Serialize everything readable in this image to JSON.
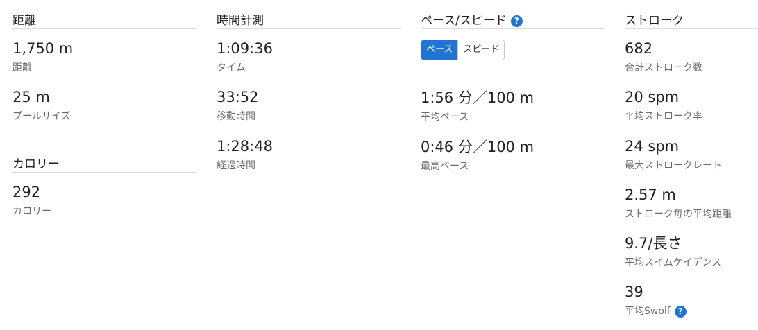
{
  "col1": {
    "title": "距離",
    "stats": [
      {
        "value": "1,750 m",
        "label": "距離"
      },
      {
        "value": "25 m",
        "label": "プールサイズ"
      }
    ],
    "calorie_title": "カロリー",
    "calorie_stats": [
      {
        "value": "292",
        "label": "カロリー"
      }
    ]
  },
  "col2": {
    "title": "時間計測",
    "stats": [
      {
        "value": "1:09:36",
        "label": "タイム"
      },
      {
        "value": "33:52",
        "label": "移動時間"
      },
      {
        "value": "1:28:48",
        "label": "経過時間"
      }
    ]
  },
  "col3": {
    "title": "ペース/スピード",
    "help_icon": "?",
    "toggle": {
      "pace": "ペース",
      "speed": "スピード"
    },
    "stats": [
      {
        "value": "1:56 分／100 m",
        "label": "平均ペース"
      },
      {
        "value": "0:46 分／100 m",
        "label": "最高ペース"
      }
    ]
  },
  "col4": {
    "title": "ストローク",
    "stats": [
      {
        "value": "682",
        "label": "合計ストローク数"
      },
      {
        "value": "20 spm",
        "label": "平均ストローク率"
      },
      {
        "value": "24 spm",
        "label": "最大ストロークレート"
      },
      {
        "value": "2.57 m",
        "label": "ストローク毎の平均距離"
      },
      {
        "value": "9.7/長さ",
        "label": "平均スイムケイデンス"
      },
      {
        "value": "39",
        "label": "平均Swolf"
      }
    ],
    "help_icon": "?"
  },
  "colors": {
    "accent": "#1f74d4",
    "label": "#6b6b6b",
    "rule": "#dcdcdc"
  }
}
